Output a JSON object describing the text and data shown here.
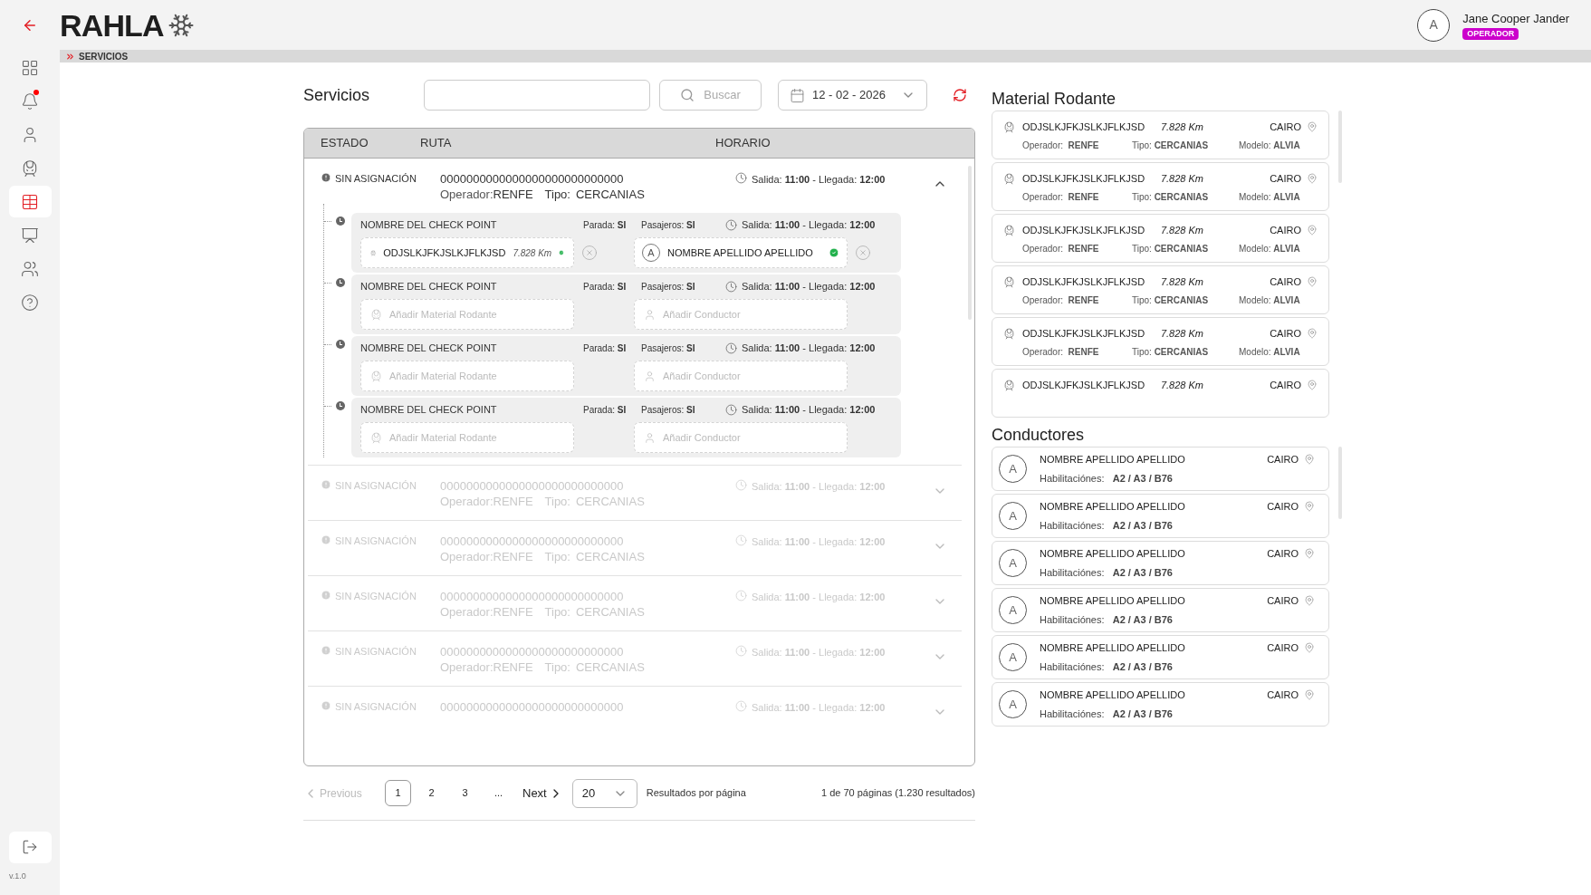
{
  "header": {
    "logo": "RAHLA",
    "user": {
      "initial": "A",
      "name": "Jane Cooper Jander",
      "role": "OPERADOR"
    }
  },
  "sidebar": {
    "items": [
      {
        "kind": "dashboard",
        "selected": false,
        "alert": false
      },
      {
        "kind": "notifications",
        "selected": false,
        "alert": true
      },
      {
        "kind": "people",
        "selected": false,
        "alert": false
      },
      {
        "kind": "trains",
        "selected": false,
        "alert": false
      },
      {
        "kind": "services",
        "selected": true,
        "alert": false
      },
      {
        "kind": "reports",
        "selected": false,
        "alert": false
      },
      {
        "kind": "teams",
        "selected": false,
        "alert": false
      },
      {
        "kind": "help",
        "selected": false,
        "alert": false
      }
    ],
    "version": "v.1.0"
  },
  "breadcrumb": "SERVICIOS",
  "toolbar": {
    "title": "Servicios",
    "search_button": "Buscar",
    "date": "12 - 02 - 2026"
  },
  "table": {
    "columns": [
      "ESTADO",
      "RUTA",
      "HORARIO"
    ],
    "rows": [
      {
        "status": "SIN ASIGNACIÓN",
        "route": "0000000000000000000000000000",
        "operator_label": "Operador:",
        "operator": "RENFE",
        "type_label": "Tipo:",
        "type": "CERCANIAS",
        "schedule": "Salida: **11:00** - Llegada: **12:00**",
        "expanded": true,
        "dimmed": false,
        "checkpoints": [
          {
            "name": "NOMBRE DEL CHECK POINT",
            "stop": "Parada: **SI**",
            "passengers": "Pasajeros: **SI**",
            "schedule": "Salida: **11:00** - Llegada: **12:00**",
            "material": {
              "kind": "assigned",
              "code": "ODJSLKJFKJSLKJFLKJSD",
              "km": "7.828 Km"
            },
            "driver": {
              "kind": "assigned",
              "initial": "A",
              "name": "NOMBRE APELLIDO APELLIDO"
            }
          },
          {
            "name": "NOMBRE DEL CHECK POINT",
            "stop": "Parada: **SI**",
            "passengers": "Pasajeros: **SI**",
            "schedule": "Salida: **11:00** - Llegada: **12:00**",
            "material": {
              "kind": "empty",
              "placeholder": "Añadir Material Rodante"
            },
            "driver": {
              "kind": "empty",
              "placeholder": "Añadir Conductor"
            }
          },
          {
            "name": "NOMBRE DEL CHECK POINT",
            "stop": "Parada: **SI**",
            "passengers": "Pasajeros: **SI**",
            "schedule": "Salida: **11:00** - Llegada: **12:00**",
            "material": {
              "kind": "empty",
              "placeholder": "Añadir Material Rodante"
            },
            "driver": {
              "kind": "empty",
              "placeholder": "Añadir Conductor"
            }
          },
          {
            "name": "NOMBRE DEL CHECK POINT",
            "stop": "Parada: **SI**",
            "passengers": "Pasajeros: **SI**",
            "schedule": "Salida: **11:00** - Llegada: **12:00**",
            "material": {
              "kind": "empty",
              "placeholder": "Añadir Material Rodante"
            },
            "driver": {
              "kind": "empty",
              "placeholder": "Añadir Conductor"
            }
          }
        ]
      },
      {
        "status": "SIN ASIGNACIÓN",
        "route": "0000000000000000000000000000",
        "operator_label": "Operador:",
        "operator": "RENFE",
        "type_label": "Tipo:",
        "type": "CERCANIAS",
        "schedule": "Salida: **11:00** - Llegada: **12:00**",
        "expanded": false,
        "dimmed": true
      },
      {
        "status": "SIN ASIGNACIÓN",
        "route": "0000000000000000000000000000",
        "operator_label": "Operador:",
        "operator": "RENFE",
        "type_label": "Tipo:",
        "type": "CERCANIAS",
        "schedule": "Salida: **11:00** - Llegada: **12:00**",
        "expanded": false,
        "dimmed": true
      },
      {
        "status": "SIN ASIGNACIÓN",
        "route": "0000000000000000000000000000",
        "operator_label": "Operador:",
        "operator": "RENFE",
        "type_label": "Tipo:",
        "type": "CERCANIAS",
        "schedule": "Salida: **11:00** - Llegada: **12:00**",
        "expanded": false,
        "dimmed": true
      },
      {
        "status": "SIN ASIGNACIÓN",
        "route": "0000000000000000000000000000",
        "operator_label": "Operador:",
        "operator": "RENFE",
        "type_label": "Tipo:",
        "type": "CERCANIAS",
        "schedule": "Salida: **11:00** - Llegada: **12:00**",
        "expanded": false,
        "dimmed": true
      },
      {
        "status": "SIN ASIGNACIÓN",
        "route": "0000000000000000000000000000",
        "schedule": "Salida: **11:00** - Llegada: **12:00**",
        "expanded": false,
        "dimmed": true
      }
    ]
  },
  "pagination": {
    "previous": "Previous",
    "previous_disabled": true,
    "pages": [
      {
        "label": "1",
        "selected": true
      },
      {
        "label": "2",
        "selected": false
      },
      {
        "label": "3",
        "selected": false
      },
      {
        "label": "...",
        "selected": false
      }
    ],
    "next": "Next",
    "page_size": "20",
    "page_size_label": "Resultados por página",
    "summary": "1 de 70 páginas (1.230 resultados)"
  },
  "material_panel": {
    "title": "Material Rodante",
    "items": [
      {
        "code": "ODJSLKJFKJSLKJFLKJSD",
        "km": "7.828 Km",
        "city": "CAIRO",
        "details": "Operador:  **RENFE**",
        "type": "Tipo: **CERCANIAS**",
        "model": "Modelo: **ALVIA**"
      },
      {
        "code": "ODJSLKJFKJSLKJFLKJSD",
        "km": "7.828 Km",
        "city": "CAIRO",
        "details": "Operador:  **RENFE**",
        "type": "Tipo: **CERCANIAS**",
        "model": "Modelo: **ALVIA**"
      },
      {
        "code": "ODJSLKJFKJSLKJFLKJSD",
        "km": "7.828 Km",
        "city": "CAIRO",
        "details": "Operador:  **RENFE**",
        "type": "Tipo: **CERCANIAS**",
        "model": "Modelo: **ALVIA**"
      },
      {
        "code": "ODJSLKJFKJSLKJFLKJSD",
        "km": "7.828 Km",
        "city": "CAIRO",
        "details": "Operador:  **RENFE**",
        "type": "Tipo: **CERCANIAS**",
        "model": "Modelo: **ALVIA**"
      },
      {
        "code": "ODJSLKJFKJSLKJFLKJSD",
        "km": "7.828 Km",
        "city": "CAIRO",
        "details": "Operador:  **RENFE**",
        "type": "Tipo: **CERCANIAS**",
        "model": "Modelo: **ALVIA**"
      },
      {
        "code": "ODJSLKJFKJSLKJFLKJSD",
        "km": "7.828 Km",
        "city": "CAIRO"
      }
    ]
  },
  "drivers_panel": {
    "title": "Conductores",
    "items": [
      {
        "initial": "A",
        "name": "NOMBRE APELLIDO APELLIDO",
        "city": "CAIRO",
        "licenses": "Habilitaciónes:   **A2 / A3 / B76**"
      },
      {
        "initial": "A",
        "name": "NOMBRE APELLIDO APELLIDO",
        "city": "CAIRO",
        "licenses": "Habilitaciónes:   **A2 / A3 / B76**"
      },
      {
        "initial": "A",
        "name": "NOMBRE APELLIDO APELLIDO",
        "city": "CAIRO",
        "licenses": "Habilitaciónes:   **A2 / A3 / B76**"
      },
      {
        "initial": "A",
        "name": "NOMBRE APELLIDO APELLIDO",
        "city": "CAIRO",
        "licenses": "Habilitaciónes:   **A2 / A3 / B76**"
      },
      {
        "initial": "A",
        "name": "NOMBRE APELLIDO APELLIDO",
        "city": "CAIRO",
        "licenses": "Habilitaciónes:   **A2 / A3 / B76**"
      },
      {
        "initial": "A",
        "name": "NOMBRE APELLIDO APELLIDO",
        "city": "CAIRO",
        "licenses": "Habilitaciónes:   **A2 / A3 / B76**"
      }
    ]
  }
}
